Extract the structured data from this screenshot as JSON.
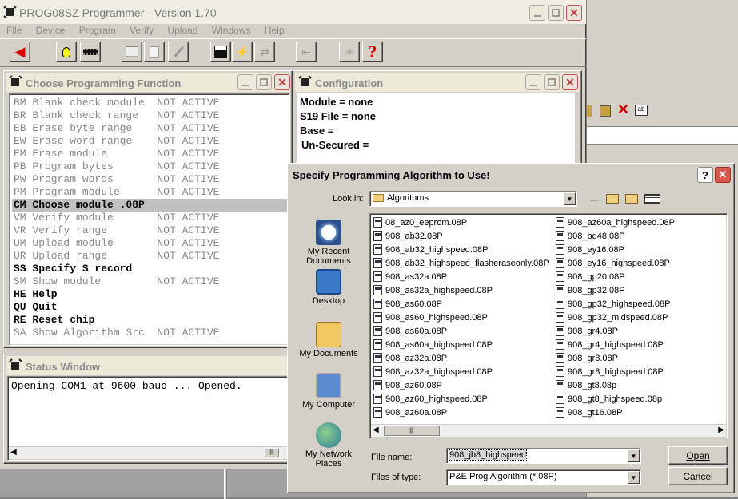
{
  "app": {
    "title": "PROG08SZ Programmer - Version 1.70",
    "menu": [
      "File",
      "Device",
      "Program",
      "Verify",
      "Upload",
      "Windows",
      "Help"
    ]
  },
  "choose_window": {
    "title": "Choose Programming Function",
    "items": [
      {
        "text": "BM Blank check module  NOT ACTIVE",
        "active": false
      },
      {
        "text": "BR Blank check range   NOT ACTIVE",
        "active": false
      },
      {
        "text": "EB Erase byte range    NOT ACTIVE",
        "active": false
      },
      {
        "text": "EW Erase word range    NOT ACTIVE",
        "active": false
      },
      {
        "text": "EM Erase module        NOT ACTIVE",
        "active": false
      },
      {
        "text": "PB Program bytes       NOT ACTIVE",
        "active": false
      },
      {
        "text": "PW Program words       NOT ACTIVE",
        "active": false
      },
      {
        "text": "PM Program module      NOT ACTIVE",
        "active": false
      },
      {
        "text": "CM Choose module .08P",
        "active": true,
        "selected": true
      },
      {
        "text": "VM Verify module       NOT ACTIVE",
        "active": false
      },
      {
        "text": "VR Verify range        NOT ACTIVE",
        "active": false
      },
      {
        "text": "UM Upload module       NOT ACTIVE",
        "active": false
      },
      {
        "text": "UR Upload range        NOT ACTIVE",
        "active": false
      },
      {
        "text": "SS Specify S record",
        "active": true
      },
      {
        "text": "SM Show module         NOT ACTIVE",
        "active": false
      },
      {
        "text": "HE Help",
        "active": true
      },
      {
        "text": "QU Quit",
        "active": true
      },
      {
        "text": "RE Reset chip",
        "active": true
      },
      {
        "text": "SA Show Algorithm Src  NOT ACTIVE",
        "active": false
      }
    ]
  },
  "config_window": {
    "title": "Configuration",
    "lines": [
      "Module = none",
      "S19 File = none",
      "Base =",
      "Un-Secured ="
    ]
  },
  "status_window": {
    "title": "Status Window",
    "text": "Opening COM1 at 9600 baud ... Opened."
  },
  "dialog": {
    "title": "Specify Programming Algorithm to Use!",
    "look_in_label": "Look in:",
    "look_in_value": "Algorithms",
    "places": [
      "My Recent Documents",
      "Desktop",
      "My Documents",
      "My Computer",
      "My Network Places"
    ],
    "files_col1": [
      "08_az0_eeprom.08P",
      "908_ab32.08P",
      "908_ab32_highspeed.08P",
      "908_ab32_highspeed_flasheraseonly.08P",
      "908_as32a.08P",
      "908_as32a_highspeed.08P",
      "908_as60.08P",
      "908_as60_highspeed.08P",
      "908_as60a.08P",
      "908_as60a_highspeed.08P",
      "908_az32a.08P",
      "908_az32a_highspeed.08P",
      "908_az60.08P",
      "908_az60_highspeed.08P",
      "908_az60a.08P"
    ],
    "files_col2": [
      "908_az60a_highspeed.08P",
      "908_bd48.08P",
      "908_ey16.08P",
      "908_ey16_highspeed.08P",
      "908_gp20.08P",
      "908_gp32.08P",
      "908_gp32_highspeed.08P",
      "908_gp32_midspeed.08P",
      "908_gr4.08P",
      "908_gr4_highspeed.08P",
      "908_gr8.08P",
      "908_gr8_highspeed.08P",
      "908_gt8.08p",
      "908_gt8_highspeed.08p",
      "908_gt16.08P"
    ],
    "file_name_label": "File name:",
    "file_name_value": "908_jb8_highspeed",
    "file_type_label": "Files of type:",
    "file_type_value": "P&E Prog Algorithm (*.08P)",
    "open_label": "Open",
    "cancel_label": "Cancel",
    "help_glyph": "?",
    "scroll_thumb_glyph": "|||"
  }
}
